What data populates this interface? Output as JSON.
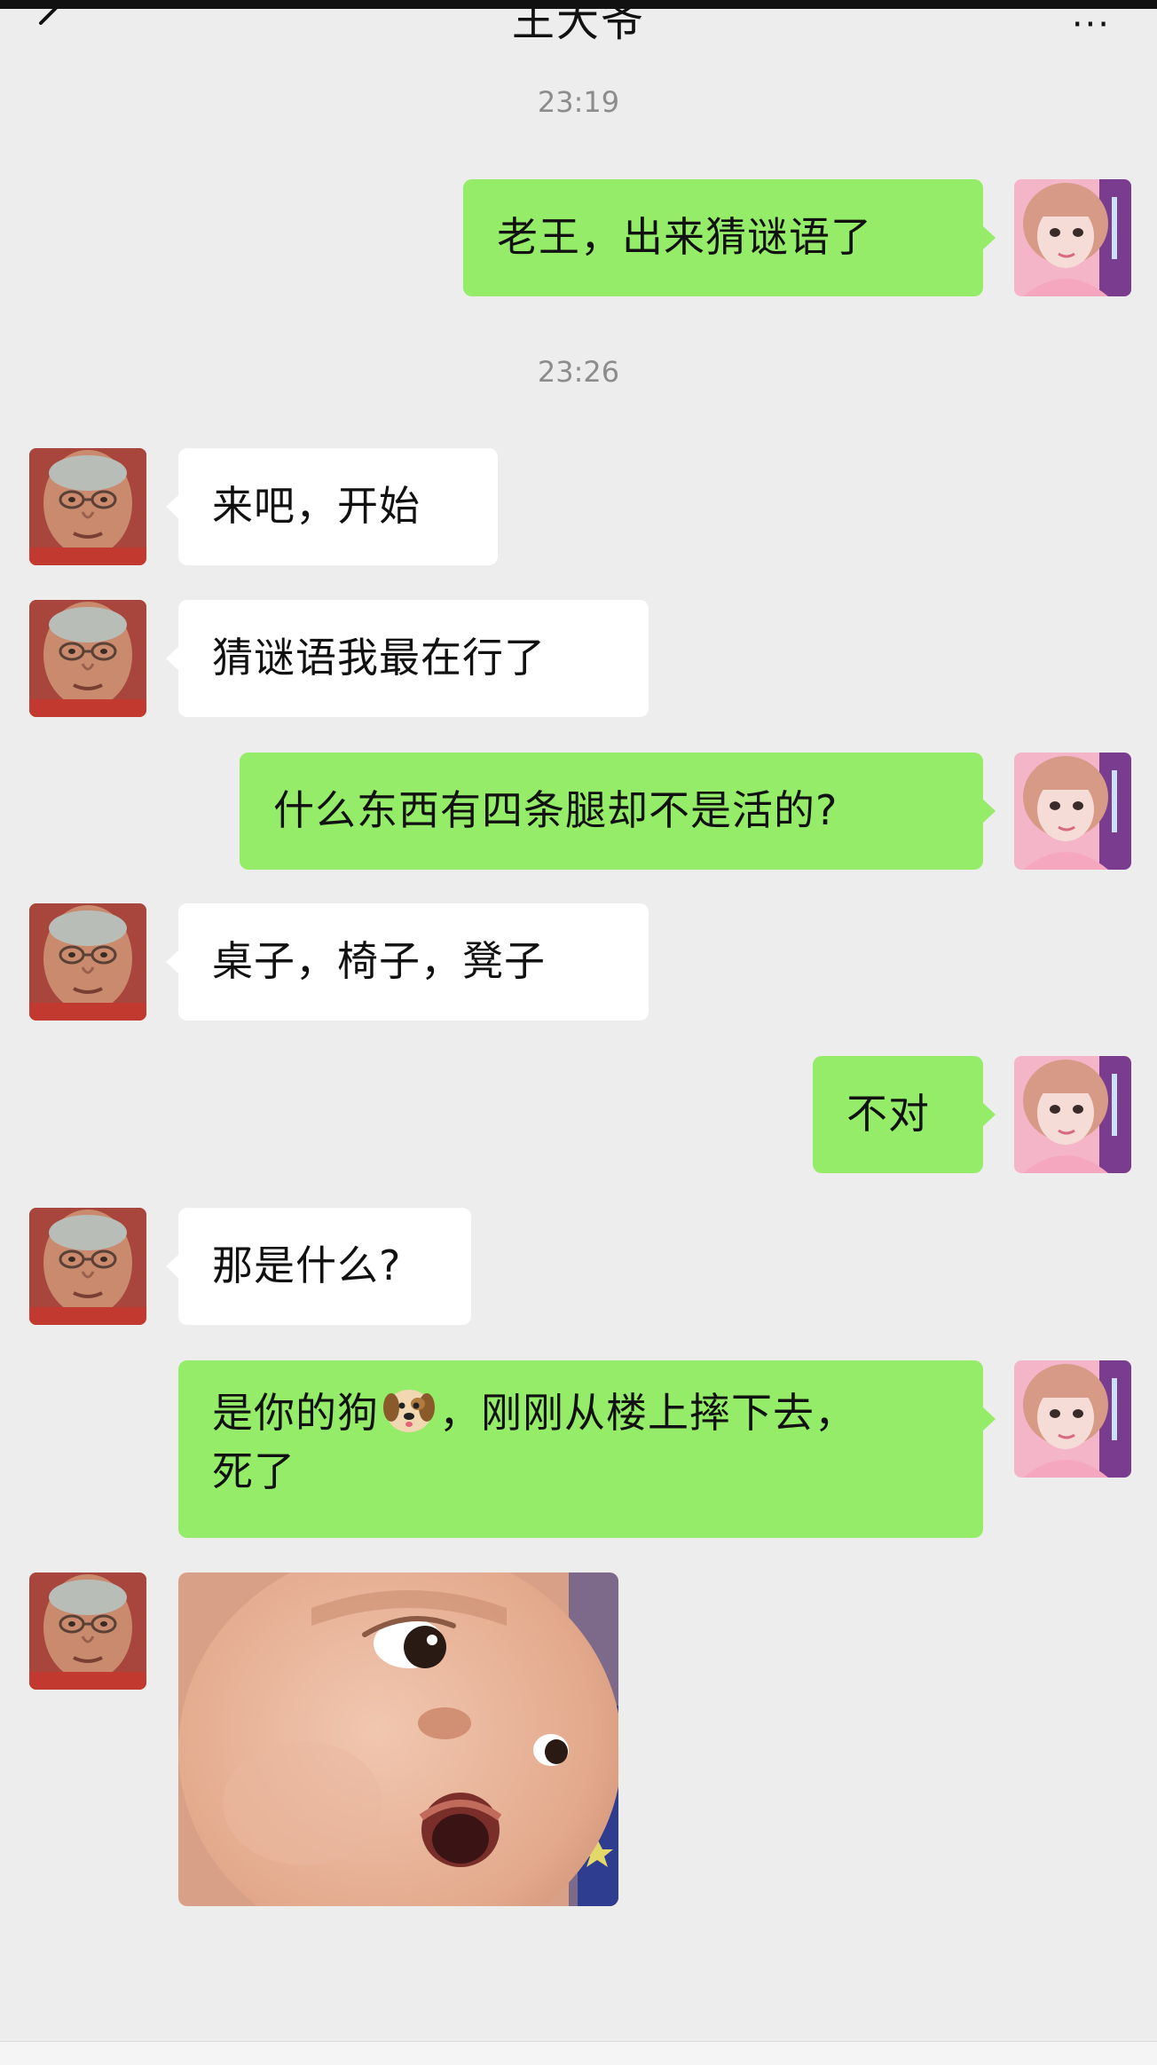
{
  "header": {
    "title": "王大爷",
    "back_icon": "chevron-left-icon",
    "more_icon": "more-icon",
    "more_glyph": "···"
  },
  "timestamps": [
    "23:19",
    "23:26"
  ],
  "messages": [
    {
      "side": "sent",
      "text": "老王，出来猜谜语了"
    },
    {
      "side": "received",
      "text": "来吧，开始"
    },
    {
      "side": "received",
      "text": "猜谜语我最在行了"
    },
    {
      "side": "sent",
      "text": "什么东西有四条腿却不是活的?"
    },
    {
      "side": "received",
      "text": "桌子，椅子，凳子"
    },
    {
      "side": "sent",
      "text": "不对"
    },
    {
      "side": "received",
      "text": "那是什么?"
    },
    {
      "side": "sent",
      "text_before_emoji": "是你的狗",
      "emoji": "dog-face-icon",
      "text_after_emoji": "，刚刚从楼上摔下去，",
      "text_line2": "死了"
    },
    {
      "side": "received",
      "type": "sticker",
      "sticker": "surprised-baby-sticker"
    }
  ],
  "colors": {
    "background": "#ededed",
    "sent_bubble": "#95ec69",
    "received_bubble": "#ffffff",
    "timestamp_text": "#8c8c8c"
  }
}
